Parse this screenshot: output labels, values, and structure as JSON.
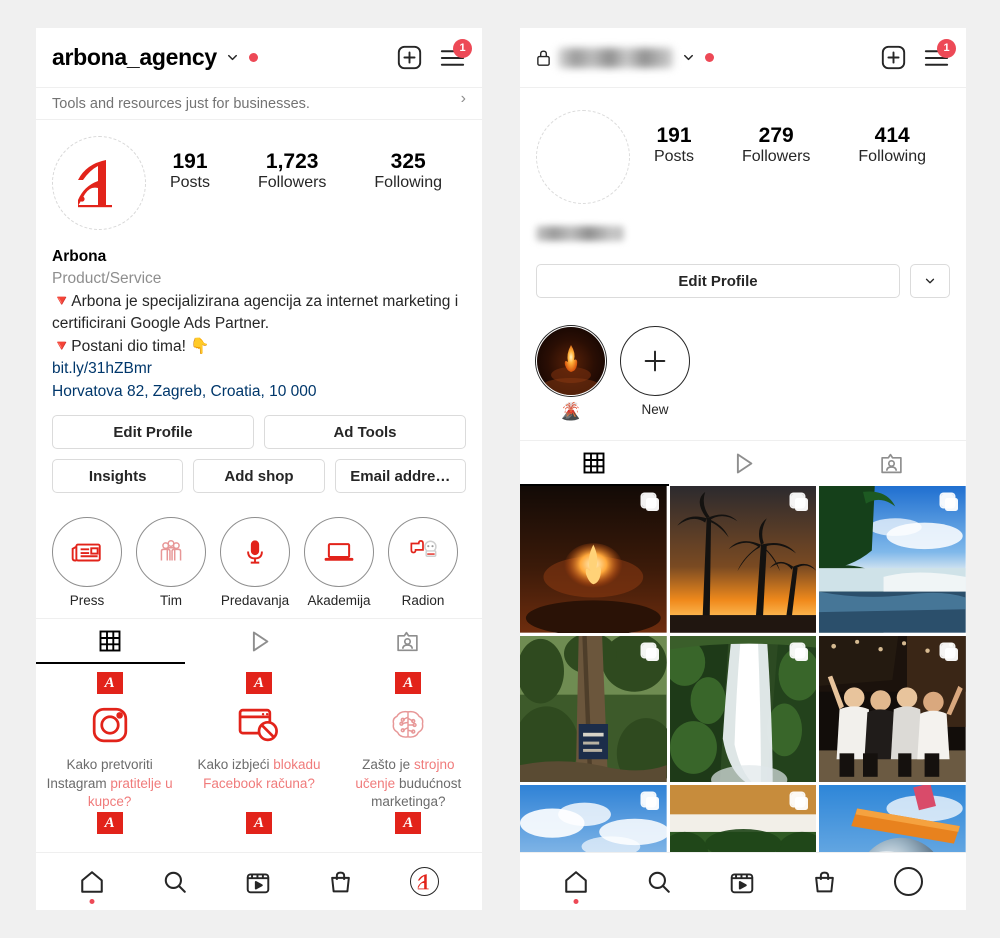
{
  "colors": {
    "brand_red": "#e2231a",
    "notification_red": "#ed4956",
    "link_blue": "#00376b",
    "muted_grey": "#8e8e8e",
    "text_dark": "#262626",
    "soft_red": "#f07b7b",
    "page_bg": "#f0f0f0"
  },
  "left": {
    "topbar": {
      "username": "arbona_agency",
      "chevron_icon": "chevron-down-icon",
      "status_dot": "red-dot-icon",
      "add_icon": "plus-square-icon",
      "menu_icon": "hamburger-menu-icon",
      "menu_badge": "1"
    },
    "business_banner": {
      "text": "Tools and resources just for businesses.",
      "chevron": "›"
    },
    "profile": {
      "avatar_icon": "arbona-logo-avatar",
      "stats": [
        {
          "num": "191",
          "label": "Posts"
        },
        {
          "num": "1,723",
          "label": "Followers"
        },
        {
          "num": "325",
          "label": "Following"
        }
      ],
      "display_name": "Arbona",
      "category": "Product/Service",
      "bio_line_1": "🔻Arbona je specijalizirana agencija za internet marketing i certificirani Google Ads Partner.",
      "bio_line_2": "🔻Postani dio tima! 👇",
      "website": "bit.ly/31hZBmr",
      "address": "Horvatova 82, Zagreb, Croatia, 10 000"
    },
    "buttons": {
      "row1": [
        {
          "label": "Edit Profile",
          "name": "edit-profile-button"
        },
        {
          "label": "Ad Tools",
          "name": "ad-tools-button"
        }
      ],
      "row2": [
        {
          "label": "Insights",
          "name": "insights-button"
        },
        {
          "label": "Add shop",
          "name": "add-shop-button"
        },
        {
          "label": "Email addre…",
          "name": "email-address-button"
        }
      ]
    },
    "highlights": [
      {
        "label": "Press",
        "icon": "newspaper-icon"
      },
      {
        "label": "Tim",
        "icon": "people-group-icon"
      },
      {
        "label": "Predavanja",
        "icon": "microphone-icon"
      },
      {
        "label": "Akademija",
        "icon": "laptop-icon"
      },
      {
        "label": "Radion",
        "icon": "puzzle-robot-icon"
      }
    ],
    "tabs": [
      {
        "name": "tab-grid",
        "icon": "grid-icon",
        "active": true
      },
      {
        "name": "tab-reels",
        "icon": "play-triangle-icon",
        "active": false
      },
      {
        "name": "tab-tagged",
        "icon": "tagged-person-icon",
        "active": false
      }
    ],
    "posts": [
      {
        "logo": "A",
        "icon": "instagram-camera-icon",
        "text_plain_1": "Kako pretvoriti",
        "text_plain_2": "Instagram",
        "text_highlight": "pratitelje u kupce?"
      },
      {
        "logo": "A",
        "icon": "blocked-browser-icon",
        "text_plain_1": "Kako izbjeći",
        "text_highlight": "blokadu Facebook računa?",
        "text_plain_2": ""
      },
      {
        "logo": "A",
        "icon": "brain-circuit-icon",
        "text_plain_1": "Zašto je ",
        "text_highlight": "strojno učenje",
        "text_plain_2": " budućnost marketinga?"
      }
    ],
    "bottom_nav": [
      {
        "name": "nav-home",
        "icon": "home-icon",
        "dot": true
      },
      {
        "name": "nav-search",
        "icon": "search-icon",
        "dot": false
      },
      {
        "name": "nav-reels",
        "icon": "reels-icon",
        "dot": false
      },
      {
        "name": "nav-shop",
        "icon": "shopping-bag-icon",
        "dot": false
      },
      {
        "name": "nav-profile",
        "icon": "profile-avatar-icon",
        "dot": false
      }
    ]
  },
  "right": {
    "topbar": {
      "lock_icon": "lock-icon",
      "username": "",
      "username_redacted": true,
      "chevron_icon": "chevron-down-icon",
      "status_dot": "red-dot-icon",
      "add_icon": "plus-square-icon",
      "menu_icon": "hamburger-menu-icon",
      "menu_badge": "1"
    },
    "profile": {
      "avatar_icon": "empty-avatar-placeholder",
      "stats": [
        {
          "num": "191",
          "label": "Posts"
        },
        {
          "num": "279",
          "label": "Followers"
        },
        {
          "num": "414",
          "label": "Following"
        }
      ],
      "display_name": "",
      "display_name_redacted": true
    },
    "buttons": {
      "edit_profile": "Edit Profile",
      "caret_icon": "chevron-down-icon"
    },
    "highlights": [
      {
        "label": "🌋",
        "icon": "volcano-story-thumbnail",
        "type": "photo"
      },
      {
        "label": "New",
        "icon": "plus-icon",
        "type": "new"
      }
    ],
    "tabs": [
      {
        "name": "tab-grid",
        "icon": "grid-icon",
        "active": true
      },
      {
        "name": "tab-reels",
        "icon": "play-triangle-icon",
        "active": false
      },
      {
        "name": "tab-tagged",
        "icon": "tagged-person-icon",
        "active": false
      }
    ],
    "photos": [
      {
        "alt": "bonfire-at-night-on-beach",
        "multi": true
      },
      {
        "alt": "palm-trees-at-sunset",
        "multi": true
      },
      {
        "alt": "tropical-beach-with-palms",
        "multi": true
      },
      {
        "alt": "sign-on-tree-in-jungle",
        "multi": true
      },
      {
        "alt": "waterfall-in-green-canyon",
        "multi": true
      },
      {
        "alt": "group-of-friends-at-night",
        "multi": true
      },
      {
        "alt": "coastline-under-blue-sky",
        "multi": true
      },
      {
        "alt": "group-photo-under-tree-canopy",
        "multi": true
      },
      {
        "alt": "mirrored-sphere-sculpture",
        "multi": false
      }
    ],
    "bottom_nav": [
      {
        "name": "nav-home",
        "icon": "home-icon",
        "dot": true
      },
      {
        "name": "nav-search",
        "icon": "search-icon",
        "dot": false
      },
      {
        "name": "nav-reels",
        "icon": "reels-icon",
        "dot": false
      },
      {
        "name": "nav-shop",
        "icon": "shopping-bag-icon",
        "dot": false
      },
      {
        "name": "nav-profile",
        "icon": "empty-avatar-icon",
        "dot": false
      }
    ]
  }
}
